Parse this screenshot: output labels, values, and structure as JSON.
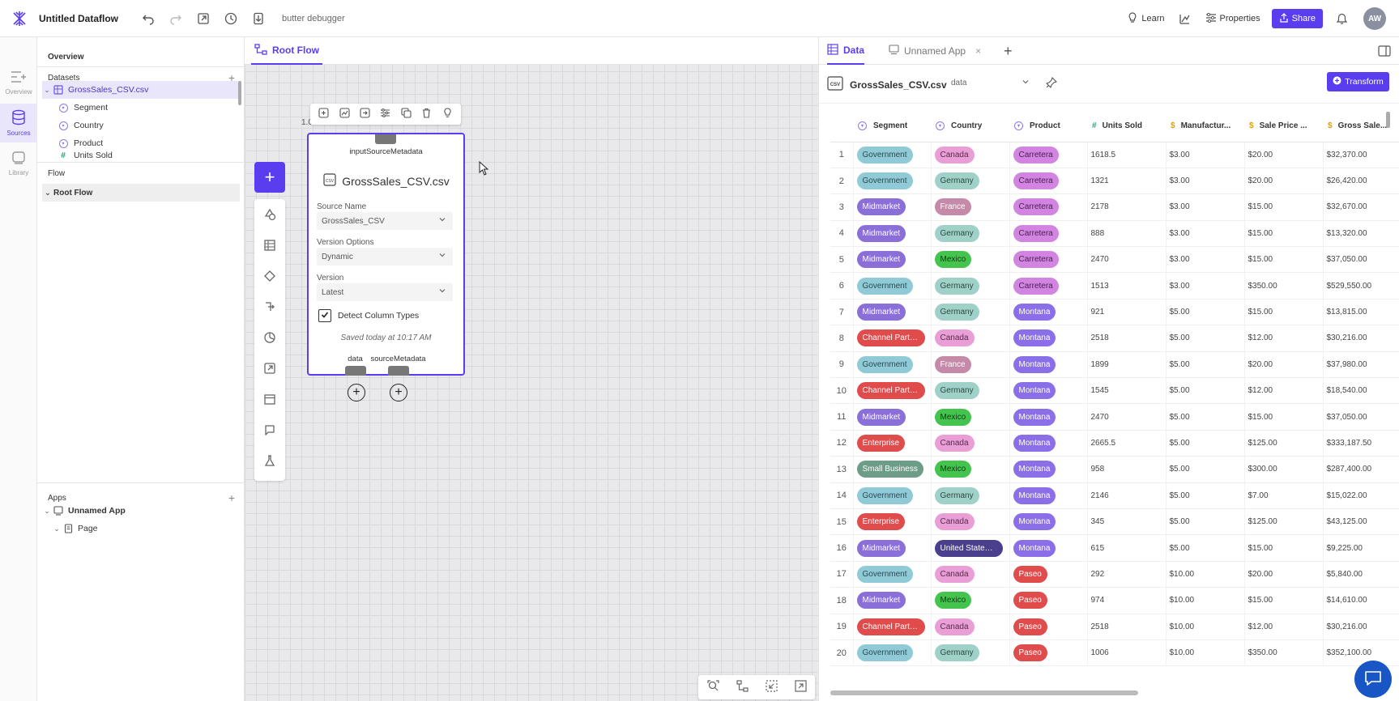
{
  "app": {
    "title": "Untitled Dataflow",
    "debugger_label": "butter debugger",
    "user_initials": "AW"
  },
  "header": {
    "learn": "Learn",
    "properties": "Properties",
    "share": "Share"
  },
  "rail": [
    {
      "label": "Overview"
    },
    {
      "label": "Sources"
    },
    {
      "label": "Library"
    }
  ],
  "explorer": {
    "overview": "Overview",
    "datasets_heading": "Datasets",
    "dataset_file": "GrossSales_CSV.csv",
    "columns": [
      "Segment",
      "Country",
      "Product",
      "Units Sold"
    ],
    "flow_heading": "Flow",
    "flow_item": "Root Flow",
    "apps_heading": "Apps",
    "app_item": "Unnamed App",
    "page_item": "Page"
  },
  "canvas": {
    "tab": "Root Flow",
    "node_label": "1.0",
    "node": {
      "input_port": "inputSourceMetadata",
      "title": "GrossSales_CSV.csv",
      "source_name_label": "Source Name",
      "source_name_value": "GrossSales_CSV",
      "version_options_label": "Version Options",
      "version_options_value": "Dynamic",
      "version_label": "Version",
      "version_value": "Latest",
      "detect_label": "Detect Column Types",
      "saved_text": "Saved today at 10:17 AM",
      "output_data": "data",
      "output_meta": "sourceMetadata"
    }
  },
  "panel": {
    "tab_data": "Data",
    "tab_app": "Unnamed App",
    "dataset_name": "GrossSales_CSV.csv",
    "dataset_tag": "data",
    "transform": "Transform",
    "columns": [
      {
        "key": "segment",
        "label": "Segment",
        "type": "text"
      },
      {
        "key": "country",
        "label": "Country",
        "type": "text"
      },
      {
        "key": "product",
        "label": "Product",
        "type": "text"
      },
      {
        "key": "units",
        "label": "Units Sold",
        "type": "number"
      },
      {
        "key": "mfg",
        "label": "Manufactur...",
        "type": "currency"
      },
      {
        "key": "price",
        "label": "Sale Price ...",
        "type": "currency"
      },
      {
        "key": "gross",
        "label": "Gross Sale...",
        "type": "currency"
      }
    ],
    "rows": [
      [
        "1",
        "Government",
        "Canada",
        "Carretera",
        "1618.5",
        "$3.00",
        "$20.00",
        "$32,370.00"
      ],
      [
        "2",
        "Government",
        "Germany",
        "Carretera",
        "1321",
        "$3.00",
        "$20.00",
        "$26,420.00"
      ],
      [
        "3",
        "Midmarket",
        "France",
        "Carretera",
        "2178",
        "$3.00",
        "$15.00",
        "$32,670.00"
      ],
      [
        "4",
        "Midmarket",
        "Germany",
        "Carretera",
        "888",
        "$3.00",
        "$15.00",
        "$13,320.00"
      ],
      [
        "5",
        "Midmarket",
        "Mexico",
        "Carretera",
        "2470",
        "$3.00",
        "$15.00",
        "$37,050.00"
      ],
      [
        "6",
        "Government",
        "Germany",
        "Carretera",
        "1513",
        "$3.00",
        "$350.00",
        "$529,550.00"
      ],
      [
        "7",
        "Midmarket",
        "Germany",
        "Montana",
        "921",
        "$5.00",
        "$15.00",
        "$13,815.00"
      ],
      [
        "8",
        "Channel Partn...",
        "Canada",
        "Montana",
        "2518",
        "$5.00",
        "$12.00",
        "$30,216.00"
      ],
      [
        "9",
        "Government",
        "France",
        "Montana",
        "1899",
        "$5.00",
        "$20.00",
        "$37,980.00"
      ],
      [
        "10",
        "Channel Partn...",
        "Germany",
        "Montana",
        "1545",
        "$5.00",
        "$12.00",
        "$18,540.00"
      ],
      [
        "11",
        "Midmarket",
        "Mexico",
        "Montana",
        "2470",
        "$5.00",
        "$15.00",
        "$37,050.00"
      ],
      [
        "12",
        "Enterprise",
        "Canada",
        "Montana",
        "2665.5",
        "$5.00",
        "$125.00",
        "$333,187.50"
      ],
      [
        "13",
        "Small Business",
        "Mexico",
        "Montana",
        "958",
        "$5.00",
        "$300.00",
        "$287,400.00"
      ],
      [
        "14",
        "Government",
        "Germany",
        "Montana",
        "2146",
        "$5.00",
        "$7.00",
        "$15,022.00"
      ],
      [
        "15",
        "Enterprise",
        "Canada",
        "Montana",
        "345",
        "$5.00",
        "$125.00",
        "$43,125.00"
      ],
      [
        "16",
        "Midmarket",
        "United States ...",
        "Montana",
        "615",
        "$5.00",
        "$15.00",
        "$9,225.00"
      ],
      [
        "17",
        "Government",
        "Canada",
        "Paseo",
        "292",
        "$10.00",
        "$20.00",
        "$5,840.00"
      ],
      [
        "18",
        "Midmarket",
        "Mexico",
        "Paseo",
        "974",
        "$10.00",
        "$15.00",
        "$14,610.00"
      ],
      [
        "19",
        "Channel Partn...",
        "Canada",
        "Paseo",
        "2518",
        "$10.00",
        "$12.00",
        "$30,216.00"
      ],
      [
        "20",
        "Government",
        "Germany",
        "Paseo",
        "1006",
        "$10.00",
        "$350.00",
        "$352,100.00"
      ]
    ],
    "pill_colors": {
      "Government": [
        "#8fcad6",
        "#2b4a52"
      ],
      "Midmarket": [
        "#8a6fd8",
        "#ffffff"
      ],
      "Channel Partn...": [
        "#e04b4b",
        "#ffffff"
      ],
      "Enterprise": [
        "#e04b4b",
        "#ffffff"
      ],
      "Small Business": [
        "#6d9d86",
        "#ffffff"
      ],
      "Canada": [
        "#e99fd6",
        "#5a2a4c"
      ],
      "Germany": [
        "#9fd1c8",
        "#2c4a44"
      ],
      "France": [
        "#c48aa8",
        "#ffffff"
      ],
      "Mexico": [
        "#45c34f",
        "#103a14"
      ],
      "United States ...": [
        "#4a3f8c",
        "#ffffff"
      ],
      "Carretera": [
        "#d184e0",
        "#4a1f55"
      ],
      "Montana": [
        "#8b6fe8",
        "#ffffff"
      ],
      "Paseo": [
        "#e04b4b",
        "#ffffff"
      ]
    }
  }
}
